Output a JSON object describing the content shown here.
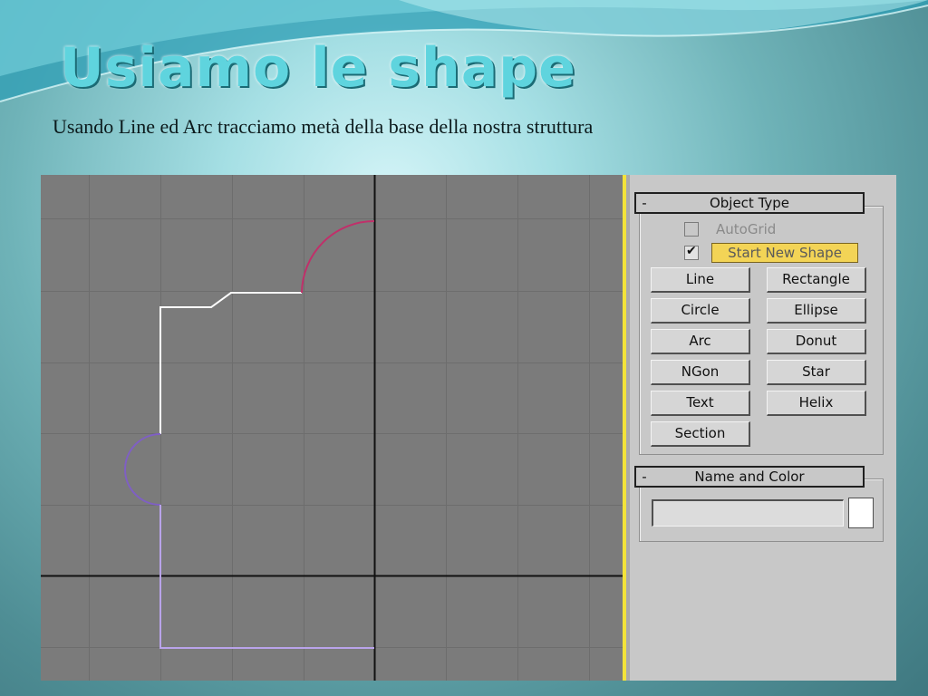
{
  "slide": {
    "title": "Usiamo le shape",
    "subtitle": "Usando Line ed Arc tracciamo metà della base della nostra struttura"
  },
  "colors": {
    "title": "#5fd4de",
    "viewport_bg": "#7b7b7b",
    "line_segment": "#ffffff",
    "arc_top": "#c0306a",
    "arc_left": "#7f5fc4",
    "lower_line": "#b9a3ea",
    "highlight_button": "#f3d456",
    "viewport_border": "#f3e33a"
  },
  "panel": {
    "object_type": {
      "header": "Object Type",
      "collapse_symbol": "-",
      "autogrid_label": "AutoGrid",
      "autogrid_checked": false,
      "start_new_shape_checked": true,
      "start_new_shape_label": "Start New Shape",
      "buttons": [
        "Line",
        "Rectangle",
        "Circle",
        "Ellipse",
        "Arc",
        "Donut",
        "NGon",
        "Star",
        "Text",
        "Helix",
        "Section"
      ]
    },
    "name_and_color": {
      "header": "Name and Color",
      "collapse_symbol": "-",
      "name_value": "",
      "color": "#ffffff"
    }
  }
}
